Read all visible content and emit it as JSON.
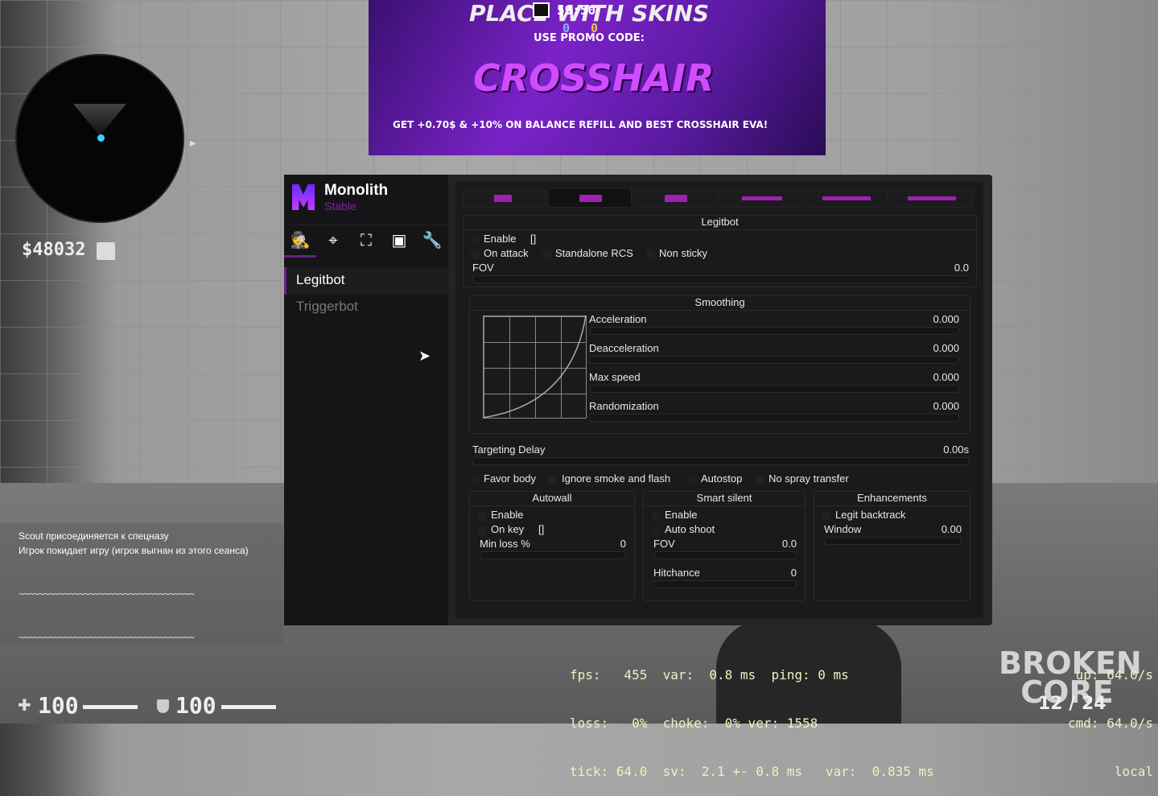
{
  "hud": {
    "timer": "59:50",
    "score_ct": "0",
    "score_t": "0",
    "money": "$48032",
    "chat": [
      "Scout присоединяется к спецназу",
      "Игрок покидает игру (игрок выгнан из этого сеанса)"
    ],
    "tilde_line": "~~~~~~~~~~~~~~~~~~~~~~~~~~~~~~~~~~~",
    "health": "100",
    "armor": "100",
    "net": {
      "line1": "fps:   455  var:  0.8 ms  ping: 0 ms",
      "line2": "loss:   0%  choke:  0% ver: 1558",
      "line3": "tick: 64.0  sv:  2.1 +- 0.8 ms   var:  0.835 ms",
      "up": "up: 64.0/s",
      "cmd": "cmd: 64.0/s",
      "local": "local"
    },
    "watermark": "BROKEN CORE",
    "ammo": "12 / 24",
    "banner": {
      "top": "PLACE WITH SKINS",
      "promo": "USE PROMO CODE:",
      "title": "CROSSHAIR",
      "bottom": "GET +0.70$ & +10% ON BALANCE REFILL AND BEST CROSSHAIR EVA!"
    }
  },
  "menu": {
    "brand": "Monolith",
    "build": "Stable",
    "accent": "#a21fb5",
    "icons": [
      "spy-icon",
      "crosshair-icon",
      "player-esp-icon",
      "box-icon",
      "wrench-icon"
    ],
    "nav": [
      "Legitbot",
      "Triggerbot"
    ],
    "weapon_tabs": [
      "pistol",
      "heavy-pistol",
      "smg",
      "rifle",
      "shotgun",
      "sniper"
    ],
    "legitbot": {
      "title": "Legitbot",
      "enable": "Enable",
      "enable_key": "[]",
      "on_attack": "On attack",
      "standalone_rcs": "Standalone RCS",
      "non_sticky": "Non sticky",
      "fov": "FOV",
      "fov_value": "0.0"
    },
    "smoothing": {
      "title": "Smoothing",
      "rows": [
        {
          "label": "Acceleration",
          "value": "0.000"
        },
        {
          "label": "Deacceleration",
          "value": "0.000"
        },
        {
          "label": "Max speed",
          "value": "0.000"
        },
        {
          "label": "Randomization",
          "value": "0.000"
        }
      ]
    },
    "targeting_delay": {
      "label": "Targeting Delay",
      "value": "0.00s"
    },
    "options": [
      "Favor body",
      "Ignore smoke and flash",
      "Autostop",
      "No spray transfer"
    ],
    "autowall": {
      "title": "Autowall",
      "enable": "Enable",
      "on_key": "On key",
      "key": "[]",
      "min_loss": "Min loss %",
      "min_loss_value": "0"
    },
    "smart_silent": {
      "title": "Smart silent",
      "enable": "Enable",
      "auto_shoot": "Auto shoot",
      "fov": "FOV",
      "fov_value": "0.0",
      "hitchance": "Hitchance",
      "hitchance_value": "0"
    },
    "enhancements": {
      "title": "Enhancements",
      "legit_backtrack": "Legit backtrack",
      "window": "Window",
      "window_value": "0.00"
    }
  }
}
